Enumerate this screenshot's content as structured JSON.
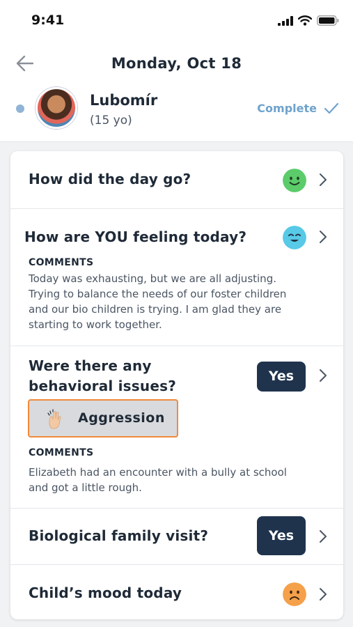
{
  "status_bar": {
    "time": "9:41"
  },
  "header": {
    "date": "Monday, Oct 18",
    "child_name": "Lubomír",
    "child_age": "(15 yo)",
    "complete_label": "Complete"
  },
  "rows": {
    "day": {
      "question": "How did the day go?",
      "mood_icon": "happy-face-icon",
      "mood_color": "#5ccc6a"
    },
    "feeling": {
      "question": "How are YOU feeling today?",
      "mood_icon": "content-face-icon",
      "mood_color": "#58c9e6",
      "comments_label": "COMMENTS",
      "comments_lines": [
        "Today was exhausting, but we are all adjusting.",
        "Trying to balance the needs of our foster children",
        "and our bio children is trying. I am glad they are",
        "starting to work together."
      ]
    },
    "behavior": {
      "question_line1": "Were there any",
      "question_line2": "behavioral issues?",
      "answer": "Yes",
      "tag_label": "Aggression",
      "tag_icon": "hand-icon",
      "comments_label": "COMMENTS",
      "comments_lines": [
        "Elizabeth had an encounter with a bully at school",
        "and got a little rough."
      ]
    },
    "visit": {
      "question": "Biological family visit?",
      "answer": "Yes"
    },
    "mood": {
      "question": "Child’s mood today",
      "mood_icon": "sad-face-icon",
      "mood_color": "#f5a04a"
    }
  },
  "colors": {
    "accent": "#6fa3cc",
    "navy": "#1f334d",
    "tag_border": "#f08a3a"
  }
}
